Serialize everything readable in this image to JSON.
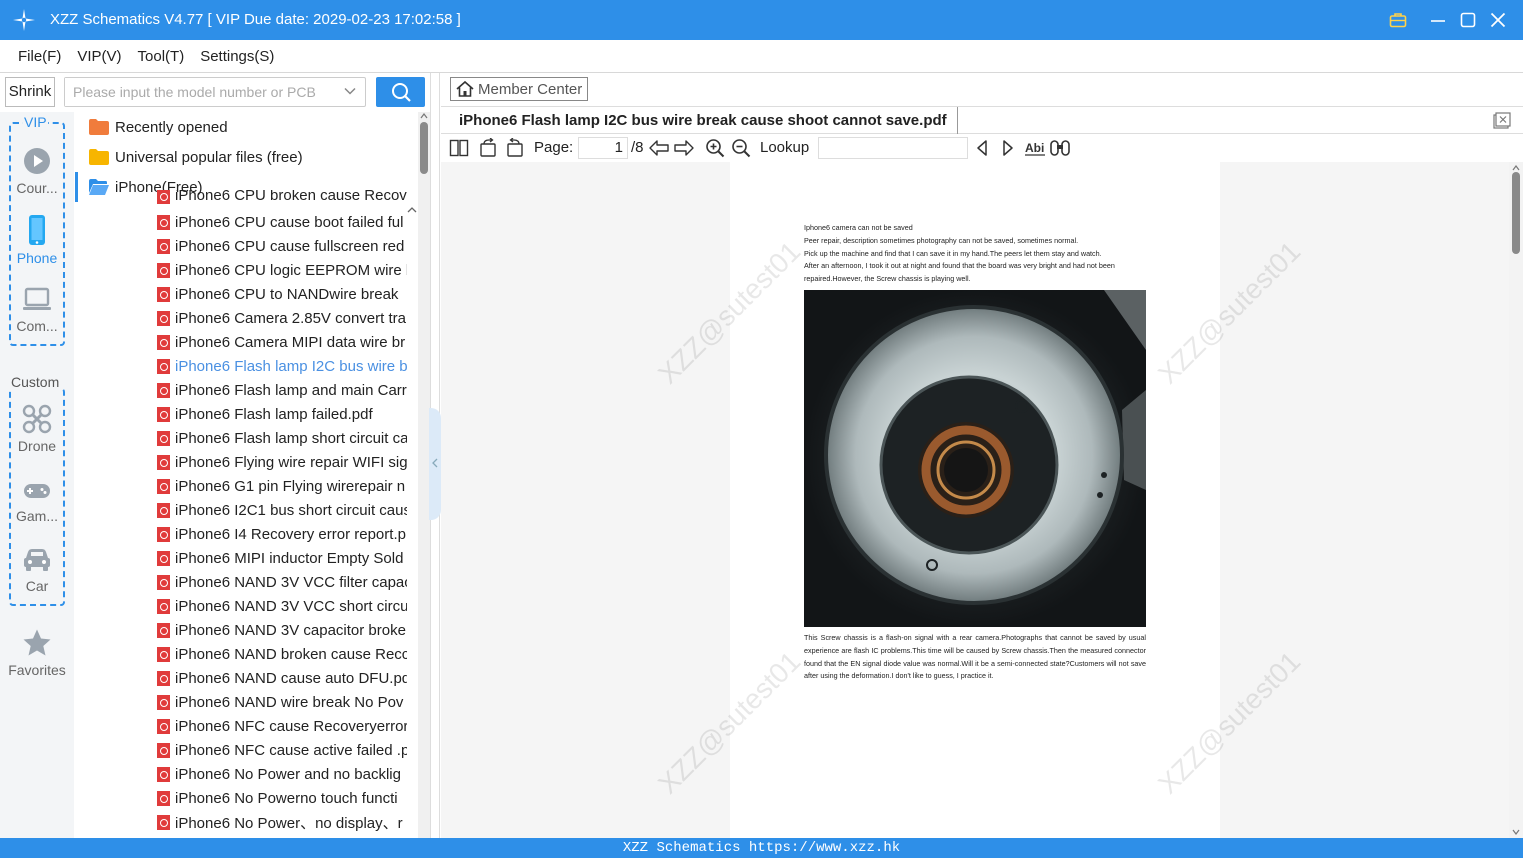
{
  "window": {
    "title": "XZZ Schematics V4.77 [ VIP Due date: 2029-02-23 17:02:58 ]"
  },
  "menu": [
    "File(F)",
    "VIP(V)",
    "Tool(T)",
    "Settings(S)"
  ],
  "search": {
    "shrink_label": "Shrink",
    "placeholder": "Please input the model number or PCB"
  },
  "categories": {
    "vip_label": "VIP",
    "custom_label": "Custom",
    "vip_items": [
      {
        "label": "Cour...",
        "icon": "play-circle-icon"
      },
      {
        "label": "Phone",
        "icon": "phone-icon"
      },
      {
        "label": "Com...",
        "icon": "laptop-icon"
      }
    ],
    "custom_items": [
      {
        "label": "Drone",
        "icon": "drone-icon"
      },
      {
        "label": "Gam...",
        "icon": "gamepad-icon"
      },
      {
        "label": "Car",
        "icon": "car-icon"
      }
    ],
    "favorites_label": "Favorites"
  },
  "tree": {
    "folders": [
      {
        "label": "Recently opened",
        "color": "#f07c3c"
      },
      {
        "label": "Universal popular files (free)",
        "color": "#f7b500"
      },
      {
        "label": "iPhone(Free)",
        "color": "#2e8fe8"
      }
    ],
    "partial_top": "iPhone6 CPU broken cause Recov",
    "files": [
      "iPhone6 CPU cause boot failed ful",
      "iPhone6 CPU cause fullscreen red .",
      "iPhone6 CPU logic EEPROM wire b",
      "iPhone6 CPU to NANDwire break",
      "iPhone6 Camera 2.85V convert trar",
      "iPhone6 Camera MIPI data wire br",
      "iPhone6 Flash lamp I2C bus wire b",
      "iPhone6 Flash lamp and main Carr",
      "iPhone6 Flash lamp failed.pdf",
      "iPhone6 Flash lamp short circuit ca",
      "iPhone6 Flying wire  repair WIFI sig",
      "iPhone6 G1 pin Flying wirerepair n",
      "iPhone6 I2C1 bus short circuit caus",
      "iPhone6 I4 Recovery error report.p",
      "iPhone6 MIPI inductor Empty Sold",
      "iPhone6 NAND 3V VCC filter capac",
      "iPhone6 NAND 3V VCC short circui",
      "iPhone6 NAND 3V capacitor broke",
      "iPhone6 NAND broken cause Recc",
      "iPhone6 NAND cause auto DFU.pd",
      "iPhone6 NAND wire break  No Pov",
      "iPhone6 NFC cause Recoveryerror r",
      "iPhone6 NFC cause active failed  .p",
      "iPhone6 No Power and no backlig",
      "iPhone6 No Powerno touch functi",
      "iPhone6 No Power、no display、r"
    ],
    "selected_index": 6,
    "selected_color": "#4a90e2"
  },
  "viewer": {
    "member_center": "Member Center",
    "tab_title": "iPhone6 Flash lamp I2C bus wire break  cause shoot cannot save.pdf",
    "page_label": "Page:",
    "page_current": "1",
    "page_total": "/8",
    "lookup_label": "Lookup",
    "doc_para1": "Iphone6 camera can not be saved\nPeer repair, description sometimes photography can not be saved, sometimes normal.\nPick up the machine and find that I can save it in my hand.The peers let them stay and watch.\nAfter an afternoon, I took it out at night and found that the board was very bright and had not been repaired.However, the Screw chassis is playing well.",
    "doc_para2": "This Screw chassis is a flash-on signal with a rear camera.Photographs that cannot be saved by usual experience are flash IC problems.This time will be caused by Screw chassis.Then the measured connector found that the EN signal diode value was normal.Will it be a semi-connected state?Customers will not save after using the deformation.I don't like to guess, I practice it.",
    "watermark": "XZZ@sutest01"
  },
  "status": {
    "text": "XZZ Schematics https://www.xzz.hk"
  },
  "colors": {
    "accent": "#2e8fe8",
    "pdf_icon": "#e03b3b"
  }
}
